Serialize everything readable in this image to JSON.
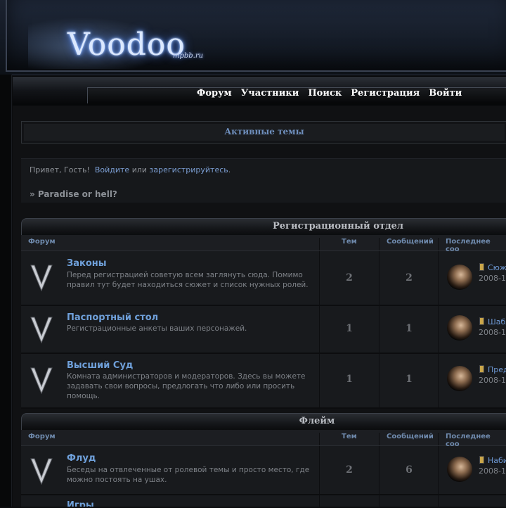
{
  "header": {
    "logo_text": "Voodoo",
    "logo_subtext": "mpbb.ru"
  },
  "nav": [
    "Форум",
    "Участники",
    "Поиск",
    "Регистрация",
    "Войти"
  ],
  "active_topics_label": "Активные темы",
  "greeting": {
    "prefix": "Привет, Гость!",
    "login_link": "Войдите",
    "or": "или",
    "register_link": "зарегистрируйтесь",
    "suffix": ".",
    "announcement": "» Paradise or hell?"
  },
  "columns": {
    "forum": "Форум",
    "topics": "Тем",
    "posts": "Сообщений",
    "last_post": "Последнее соо"
  },
  "categories": [
    {
      "title": "Регистрационный отдел",
      "forums": [
        {
          "name": "Законы",
          "desc": "Перед регистрацией советую всем заглянуть сюда. Помимо правил тут будет находиться сюжет и список нужных ролей.",
          "topics": "2",
          "posts": "2",
          "last_title": "Сюж",
          "last_date": "2008-1"
        },
        {
          "name": "Паспортный стол",
          "desc": "Регистрационные анкеты ваших персонажей.",
          "topics": "1",
          "posts": "1",
          "last_title": "Шабл",
          "last_date": "2008-1"
        },
        {
          "name": "Высший Суд",
          "desc": "Комната администраторов и модераторов. Здесь вы можете задавать свои вопросы, предлогать что либо или просить помощь.",
          "topics": "1",
          "posts": "1",
          "last_title": "Пред",
          "last_date": "2008-1"
        }
      ]
    },
    {
      "title": "Флейм",
      "forums": [
        {
          "name": "Флуд",
          "desc": "Беседы на отвлеченные от ролевой темы и просто место, где можно постоять на ушах.",
          "topics": "2",
          "posts": "6",
          "last_title": "Наби",
          "last_date": "2008-1"
        },
        {
          "name": "Игры",
          "desc": "",
          "topics": "",
          "posts": "",
          "last_title": "",
          "last_date": ""
        }
      ]
    }
  ]
}
